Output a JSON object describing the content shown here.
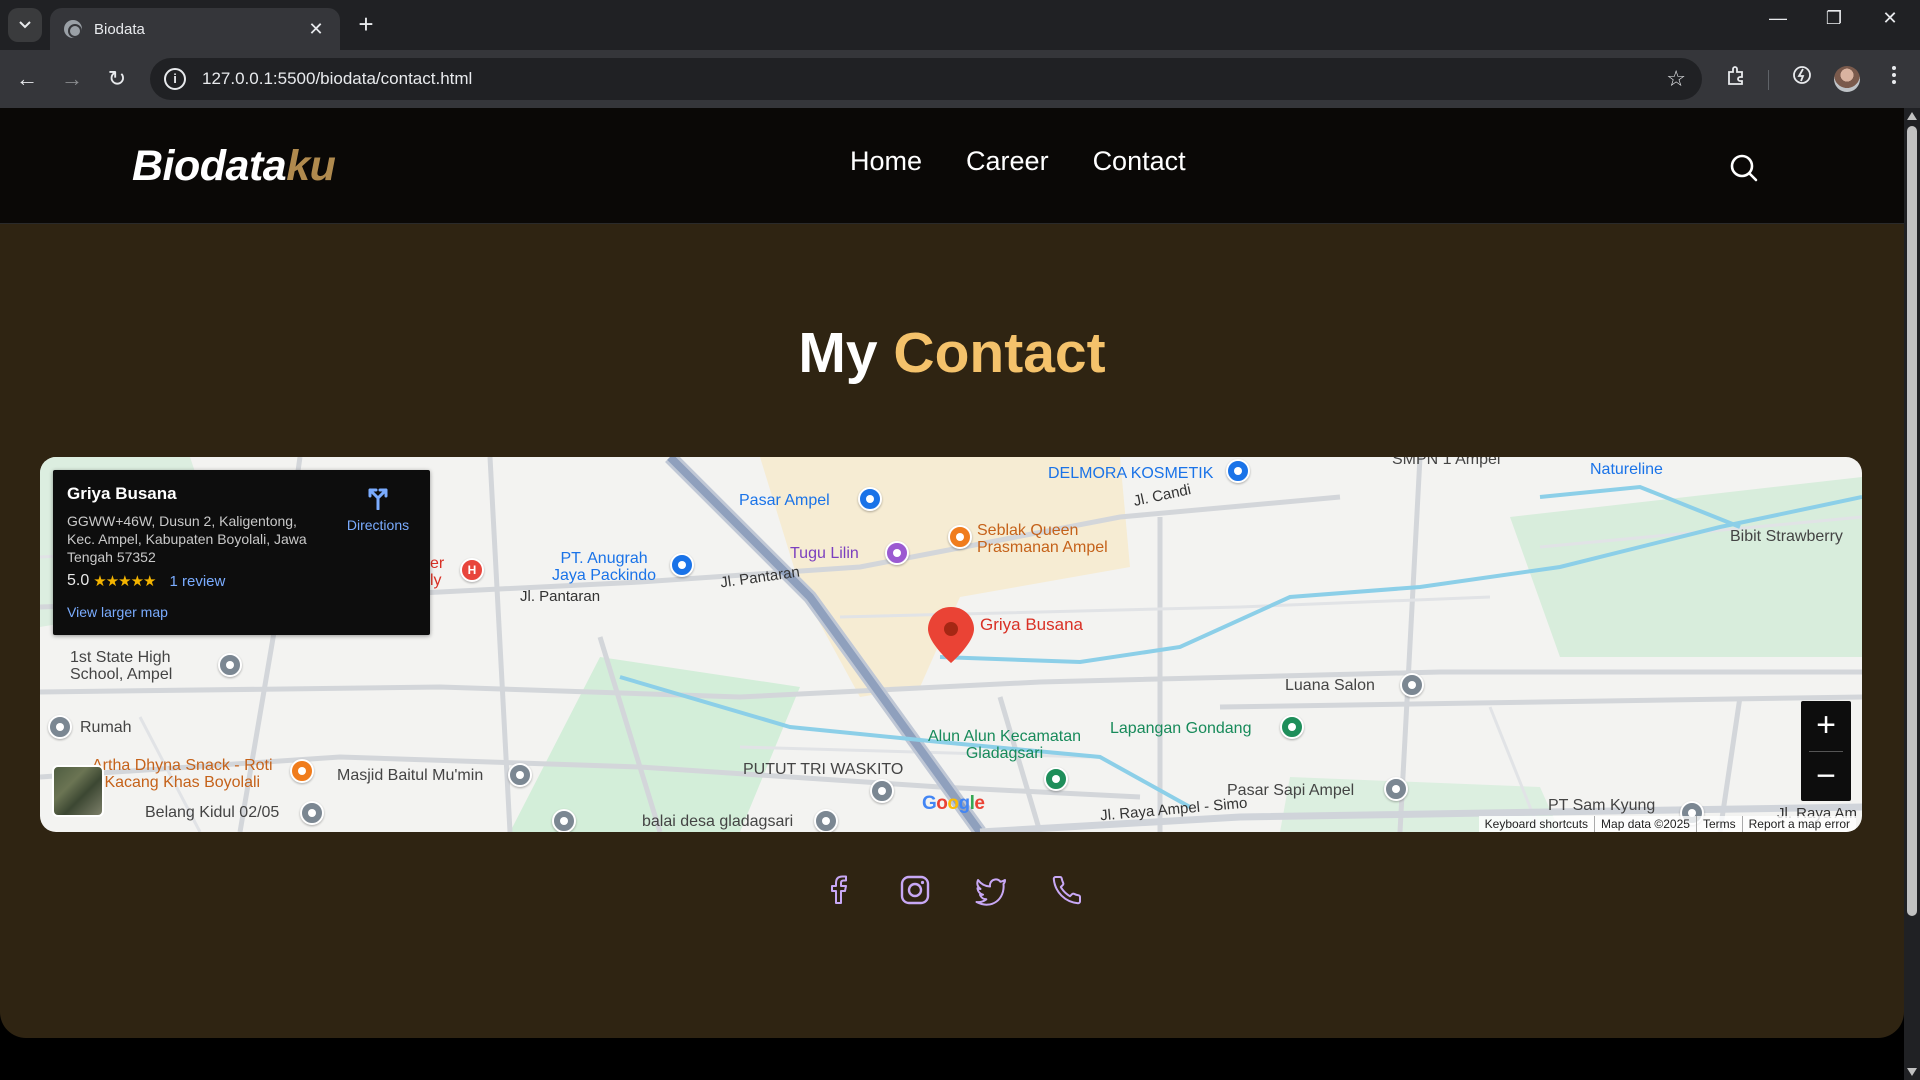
{
  "browser": {
    "tab_title": "Biodata",
    "tab_close": "✕",
    "new_tab": "+",
    "url": "127.0.0.1:5500/biodata/contact.html",
    "site_info_icon": "info-icon",
    "window_controls": {
      "minimize": "—",
      "restore": "❐",
      "close": "✕"
    },
    "nav": {
      "back": "←",
      "forward": "→",
      "reload": "↻"
    },
    "bookmark_star": "☆"
  },
  "site": {
    "logo_main": "Biodata",
    "logo_accent": "ku",
    "nav": [
      "Home",
      "Career",
      "Contact"
    ],
    "search_icon": "search-icon",
    "title_main": "My ",
    "title_accent": "Contact",
    "colors": {
      "accent": "#f4c26b",
      "logo_accent": "#b08a4e",
      "background": "#2f2412",
      "header": "#0a0806"
    }
  },
  "map": {
    "place_name": "Griya Busana",
    "address": "GGWW+46W, Dusun 2, Kaligentong, Kec. Ampel, Kabupaten Boyolali, Jawa Tengah 57352",
    "rating": "5.0",
    "stars": "★★★★★",
    "reviews": "1 review",
    "directions": "Directions",
    "view_larger": "View larger map",
    "zoom_in": "+",
    "zoom_out": "−",
    "marker_label": "Griya Busana",
    "google": [
      "G",
      "o",
      "o",
      "g",
      "l",
      "e"
    ],
    "attribution": [
      "Keyboard shortcuts",
      "Map data ©2025",
      "Terms",
      "Report a map error"
    ],
    "labels": {
      "delmora": "DELMORA KOSMETIK",
      "smpn": "SMPN 1 Ampel",
      "natureline": "Natureline",
      "bibit": "Bibit Strawberry",
      "pasar_ampel": "Pasar Ampel",
      "jl_candi": "Jl. Candi",
      "seblak": "Seblak Queen\nPrasmanan Ampel",
      "tugu": "Tugu Lilin",
      "anugrah": "PT. Anugrah\nJaya Packindo",
      "jl_pantaran_1": "Jl. Pantaran",
      "jl_pantaran_2": "Jl. Pantaran",
      "hospital_partial": "er\nly",
      "sma": "1st State High\nSchool, Ampel",
      "luana": "Luana Salon",
      "rumah": "Rumah",
      "lapangan": "Lapangan Gondang",
      "alun": "Alun Alun Kecamatan\nGladagsari",
      "artha": "Artha Dhyna Snack - Roti\nKacang Khas Boyolali",
      "masjid": "Masjid Baitul Mu'min",
      "putut": "PUTUT TRI WASKITO",
      "pasar_sapi": "Pasar Sapi Ampel",
      "pt_sam": "PT Sam Kyung",
      "belang": "Belang Kidul 02/05",
      "balai": "balai desa gladagsari",
      "jl_raya": "Jl. Raya Ampel - Simo",
      "jl_raya_am": "Jl. Raya Am",
      "hospital_glyph": "H"
    }
  },
  "socials": [
    "facebook-icon",
    "instagram-icon",
    "twitter-icon",
    "phone-icon"
  ]
}
